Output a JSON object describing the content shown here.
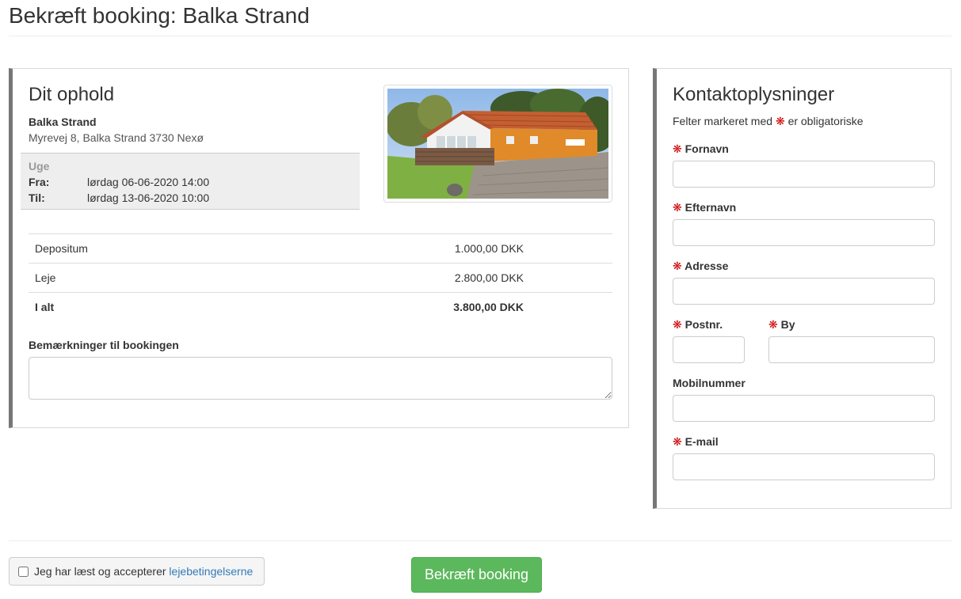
{
  "page": {
    "title": "Bekræft booking: Balka Strand"
  },
  "stay": {
    "heading": "Dit ophold",
    "name": "Balka Strand",
    "address": "Myrevej 8, Balka Strand 3730 Nexø",
    "period_type": "Uge",
    "from_label": "Fra:",
    "from_value": "lørdag 06-06-2020 14:00",
    "to_label": "Til:",
    "to_value": "lørdag 13-06-2020 10:00",
    "photo_icon": "house-photo"
  },
  "prices": [
    {
      "label": "Depositum",
      "amount": "1.000,00 DKK"
    },
    {
      "label": "Leje",
      "amount": "2.800,00 DKK"
    },
    {
      "label": "I alt",
      "amount": "3.800,00 DKK"
    }
  ],
  "remarks": {
    "label": "Bemærkninger til bookingen",
    "value": ""
  },
  "contact": {
    "heading": "Kontaktoplysninger",
    "required_note_pre": "Felter markeret med",
    "required_note_post": "er obligatoriske",
    "required_marker": "❋",
    "fields": {
      "firstname": {
        "label": "Fornavn",
        "value": ""
      },
      "lastname": {
        "label": "Efternavn",
        "value": ""
      },
      "address": {
        "label": "Adresse",
        "value": ""
      },
      "zip": {
        "label": "Postnr.",
        "value": ""
      },
      "city": {
        "label": "By",
        "value": ""
      },
      "mobile": {
        "label": "Mobilnummer",
        "value": ""
      },
      "email": {
        "label": "E-mail",
        "value": ""
      }
    }
  },
  "terms": {
    "prefix": "Jeg har læst og accepterer",
    "link": "lejebetingelserne",
    "checked": false
  },
  "submit": {
    "label": "Bekræft booking"
  },
  "colors": {
    "accent_green": "#5cb85c",
    "required_red": "#cc0000",
    "link_blue": "#337ab7",
    "panel_border": "#777777"
  }
}
